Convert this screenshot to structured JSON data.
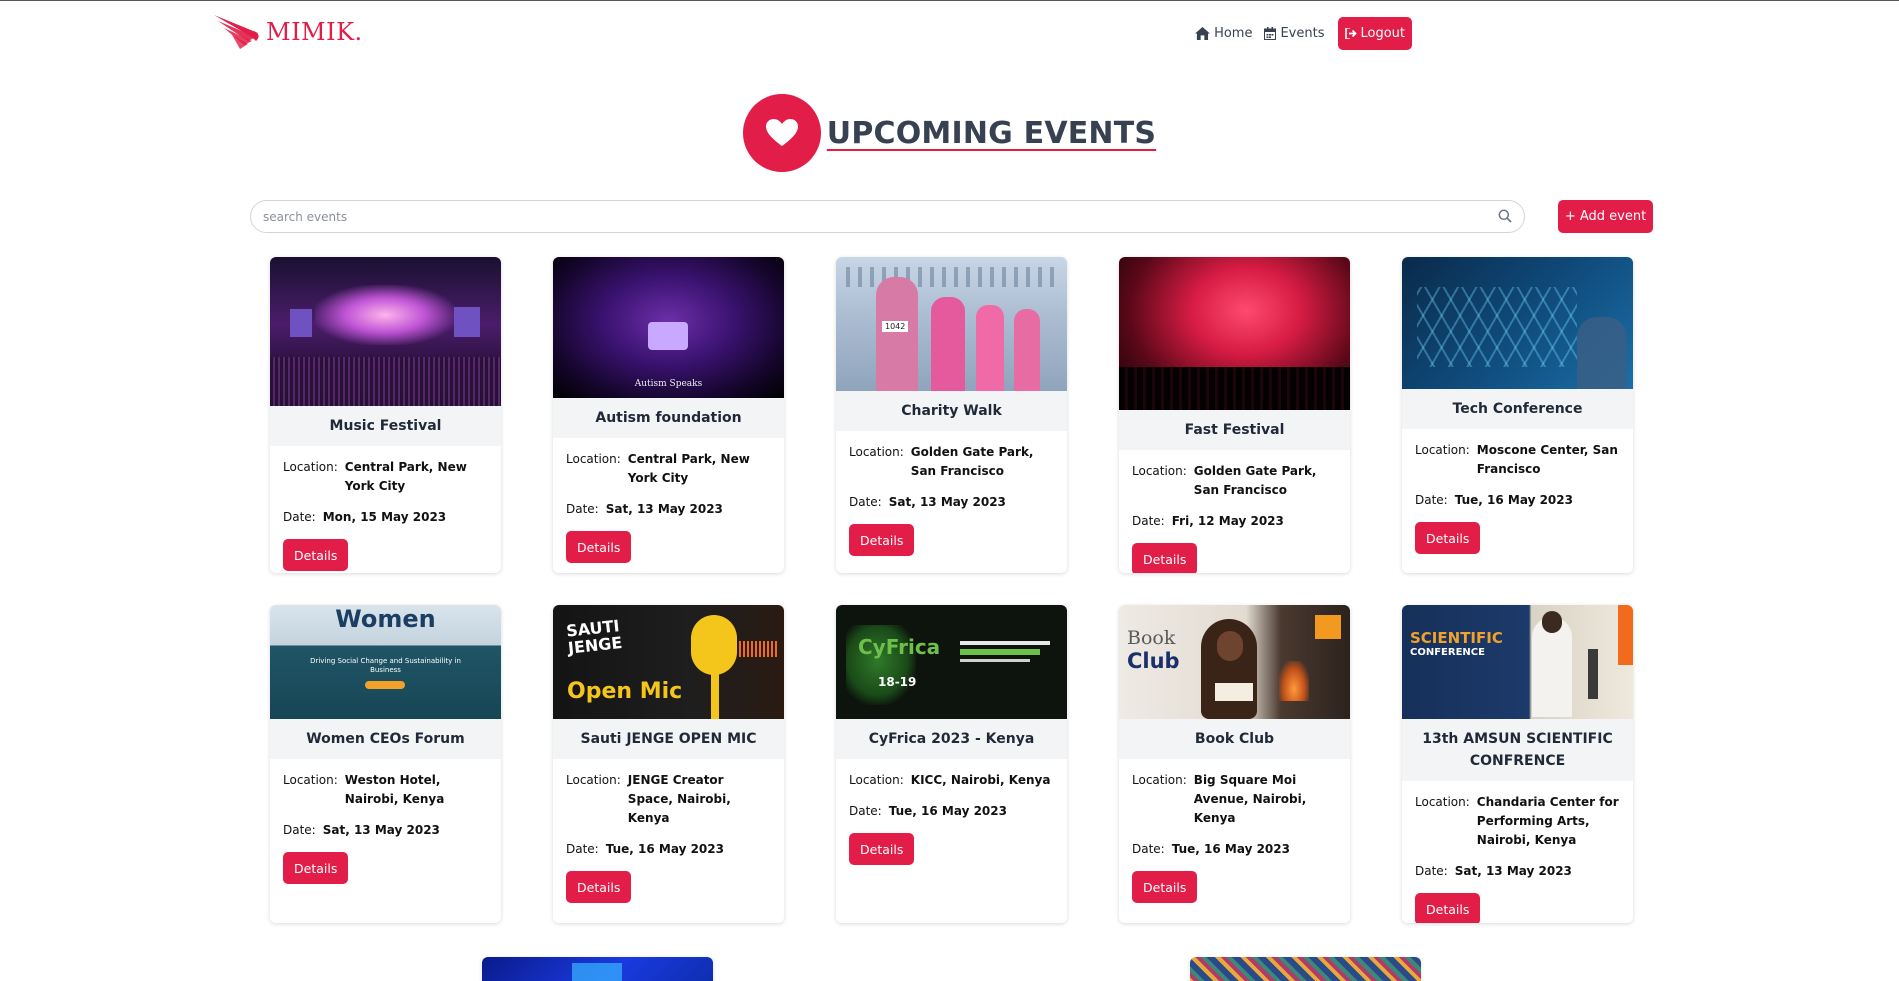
{
  "nav": {
    "brand": "MIMIK.",
    "home": "Home",
    "events": "Events",
    "logout": "Logout"
  },
  "heading": {
    "title": "UPCOMING EVENTS"
  },
  "search": {
    "placeholder": "search events",
    "value": ""
  },
  "add_event_label": "+ Add event",
  "labels": {
    "location": "Location:",
    "date": "Date:",
    "details": "Details"
  },
  "events": [
    {
      "title": "Music Festival",
      "location": "Central Park, New York City",
      "date": "Mon, 15 May 2023"
    },
    {
      "title": "Autism foundation",
      "location": "Central Park, New York City",
      "date": "Sat, 13 May 2023",
      "image_text": "Autism Speaks"
    },
    {
      "title": "Charity Walk",
      "location": "Golden Gate Park, San Francisco",
      "date": "Sat, 13 May 2023",
      "image_text": "1042"
    },
    {
      "title": "Fast Festival",
      "location": "Golden Gate Park, San Francisco",
      "date": "Fri, 12 May 2023"
    },
    {
      "title": "Tech Conference",
      "location": "Moscone Center, San Francisco",
      "date": "Tue, 16 May 2023"
    },
    {
      "title": "Women CEOs Forum",
      "location": "Weston Hotel, Nairobi, Kenya",
      "date": "Sat, 13 May 2023",
      "image_text": "Women",
      "image_sub": "Driving Social Change and Sustainability in Business"
    },
    {
      "title": "Sauti JENGE OPEN MIC",
      "location": "JENGE Creator Space, Nairobi, Kenya",
      "date": "Tue, 16 May 2023",
      "image_text": "SAUTI JENGE",
      "image_sub": "Open Mic"
    },
    {
      "title": "CyFrica 2023 - Kenya",
      "location": "KICC, Nairobi, Kenya",
      "date": "Tue, 16 May 2023",
      "image_text": "CyFrica",
      "image_sub": "18-19"
    },
    {
      "title": "Book Club",
      "location": "Big Square Moi Avenue, Nairobi, Kenya",
      "date": "Tue, 16 May 2023",
      "image_text": "Book",
      "image_sub": "Club"
    },
    {
      "title": "13th AMSUN SCIENTIFIC CONFRENCE",
      "location": "Chandaria Center for Performing Arts, Nairobi, Kenya",
      "date": "Sat, 13 May 2023",
      "image_text": "SCIENTIFIC",
      "image_sub": "CONFERENCE"
    }
  ],
  "colors": {
    "accent": "#e11d48",
    "title_bg": "#f3f4f6",
    "text": "#374151"
  }
}
